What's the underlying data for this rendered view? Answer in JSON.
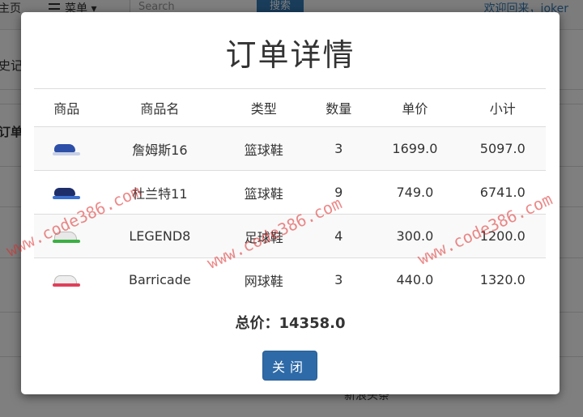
{
  "background": {
    "nav_home": "主页",
    "nav_menu": "菜单 ▾",
    "search_placeholder": "Search",
    "search_button": "搜索",
    "welcome": "欢迎回来，joker",
    "side_text_1": "史记",
    "side_text_2": "订单",
    "bottom_text": "新浪头条"
  },
  "modal": {
    "title": "订单详情",
    "columns": [
      "商品",
      "商品名",
      "类型",
      "数量",
      "单价",
      "小计"
    ],
    "rows": [
      {
        "image_icon": "blue-sneaker-icon",
        "name": "詹姆斯16",
        "type": "篮球鞋",
        "qty": "3",
        "price": "1699.0",
        "subtotal": "5097.0"
      },
      {
        "image_icon": "navy-sneaker-icon",
        "name": "杜兰特11",
        "type": "篮球鞋",
        "qty": "9",
        "price": "749.0",
        "subtotal": "6741.0"
      },
      {
        "image_icon": "white-green-sneaker-icon",
        "name": "LEGEND8",
        "type": "足球鞋",
        "qty": "4",
        "price": "300.0",
        "subtotal": "1200.0"
      },
      {
        "image_icon": "white-red-sneaker-icon",
        "name": "Barricade",
        "type": "网球鞋",
        "qty": "3",
        "price": "440.0",
        "subtotal": "1320.0"
      }
    ],
    "total_text": "总价：14358.0",
    "close_label": "关闭"
  },
  "colors": {
    "overlay": "#000000",
    "primary_button": "#2e6aa8",
    "link": "#337ab7",
    "watermark": "#dc2828"
  },
  "watermark_text": "www.code386.com"
}
